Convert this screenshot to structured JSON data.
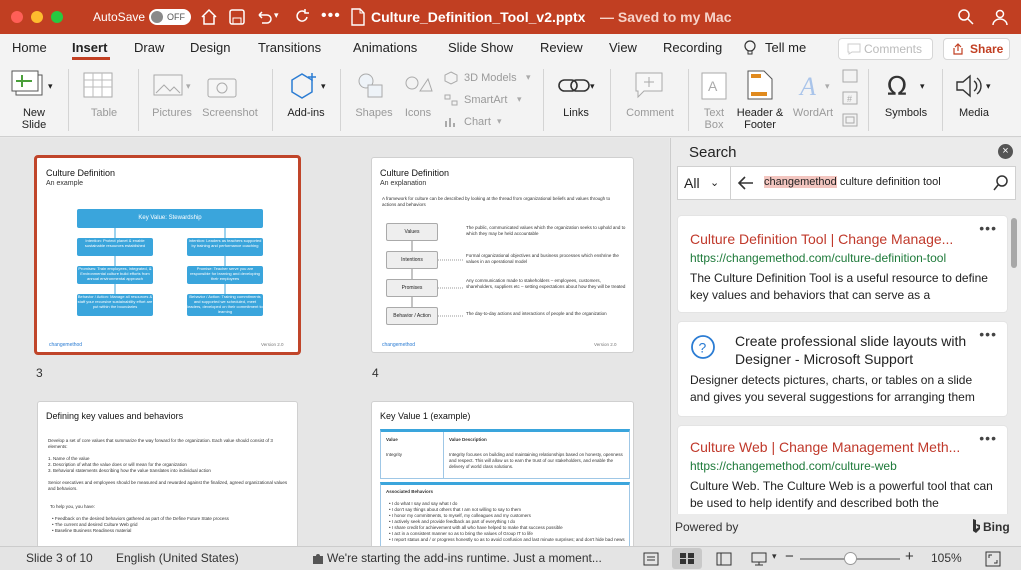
{
  "titlebar": {
    "autosave_label": "AutoSave",
    "autosave_state": "OFF",
    "filename": "Culture_Definition_Tool_v2.pptx",
    "saved_status": "— Saved to my Mac"
  },
  "tabs": [
    "Home",
    "Insert",
    "Draw",
    "Design",
    "Transitions",
    "Animations",
    "Slide Show",
    "Review",
    "View",
    "Recording"
  ],
  "tell_me": "Tell me",
  "comments_button": "Comments",
  "share_button": "Share",
  "ribbon": {
    "new_slide": "New\nSlide",
    "table": "Table",
    "pictures": "Pictures",
    "screenshot": "Screenshot",
    "addins": "Add-ins",
    "shapes": "Shapes",
    "icons": "Icons",
    "models3d": "3D Models",
    "smartart": "SmartArt",
    "chart": "Chart",
    "links": "Links",
    "comment": "Comment",
    "textbox": "Text\nBox",
    "header_footer": "Header &\nFooter",
    "wordart": "WordArt",
    "symbols": "Symbols",
    "media": "Media"
  },
  "slides": [
    {
      "num": "3",
      "title": "Culture Definition",
      "subtitle": "An example",
      "header_box": "Key Value: Stewardship",
      "left_boxes": [
        "Intention: Protect planet & enable sustainable resources established",
        "Promises: Train employees, integrated, & Environmental culture build efforts from annual environmental approach",
        "Behavior / Action: Manage all resources & staff your recursive sustainability effort are put within the boundaries"
      ],
      "right_boxes": [
        "Intention: Leaders as teachers supported by training and performance coaching",
        "Promise: Teacher serve you are responsible for learning and developing their employees",
        "Behavior / Action: Training commitments and supported we scheduled, meet leaders, developed on their commitment to learning"
      ],
      "logo": "changemethod",
      "version": "Version 2.0"
    },
    {
      "num": "4",
      "title": "Culture Definition",
      "subtitle": "An explanation",
      "intro": "A framework for culture can be described by looking at the thread from organizational beliefs and values through to actions and behaviors",
      "steps": [
        "Values",
        "Intentions",
        "Promises",
        "Behavior / Action"
      ],
      "descs": [
        "The public, communicated values which the organization seeks to uphold and to which they may be held accountable",
        "Formal organizational objectives and business processes which enshrine the values in an operational model",
        "Any communication made to stakeholders – employees, customers, shareholders, suppliers etc – setting expectations about how they will be treated",
        "The day-to-day actions and interactions of people and the organization"
      ],
      "logo": "changemethod",
      "version": "Version 2.0"
    },
    {
      "title": "Defining key values and behaviors",
      "p1": "Develop a set of core values that summarize the way forward for the organization. Each value should consist of 3 elements:",
      "items": [
        "Name of the value",
        "Description of what the value does or will mean for the organization",
        "Behavioral statements describing how the value translates into individual action"
      ],
      "p2": "Senior executives and employees should be measured and rewarded against the finalized, agreed organizational values and behaviors.",
      "help": "To help you, you have:",
      "help_items": [
        "Feedback on the desired behaviors gathered as part of the Define Future State process",
        "The current and desired Culture Web grid",
        "Baseline Business Readiness material"
      ]
    },
    {
      "title": "Key Value 1 (example)",
      "col1": "Value",
      "col2": "Value Description",
      "value": "Integrity",
      "desc": "Integrity focuses on building and maintaining relationships based on honesty, openness and respect. This will allow us to earn the trust of our stakeholders, and enable the delivery of world class solutions.",
      "assoc": "Associated Behaviors",
      "behaviors": [
        "I do what I say and say what I do",
        "I don't say things about others that I am not willing to say to them",
        "I honor my commitments, to myself, my colleagues and my customers",
        "I actively seek and provide feedback as part of everything I do",
        "I share credit for achievement with all who have helped to make that success possible",
        "I act in a consistent manner so as to bring the values of Group IT to life",
        "I report status and / or progress honestly so as to avoid confusion and last minute surprises; and don't hide bad news"
      ]
    }
  ],
  "search": {
    "header": "Search",
    "scope": "All",
    "query_highlight": "changemethod",
    "query_rest": " culture definition tool",
    "powered_by": "Powered by",
    "bing": "Bing"
  },
  "results": [
    {
      "title": "Culture Definition Tool | Change Manage...",
      "url": "https://changemethod.com/culture-definition-tool",
      "desc": "The Culture Definition Tool is a useful resource to define key values and behaviors that can serve as a"
    },
    {
      "title": "Create professional slide layouts with Designer - Microsoft Support",
      "desc": "Designer detects pictures, charts, or tables on a slide and gives you several suggestions for arranging them"
    },
    {
      "title": "Culture Web | Change Management Meth...",
      "url": "https://changemethod.com/culture-web",
      "desc": "Culture Web. The Culture Web is a powerful tool that can be used to help identify and described both the"
    }
  ],
  "status": {
    "slide": "Slide 3 of 10",
    "language": "English (United States)",
    "message": "We're starting the add-ins runtime. Just a moment...",
    "zoom": "105%"
  },
  "colors": {
    "titlebar": "#c13f22",
    "accent": "#c0392b",
    "url": "#1e7a3a",
    "selected_border": "#c0452a"
  }
}
